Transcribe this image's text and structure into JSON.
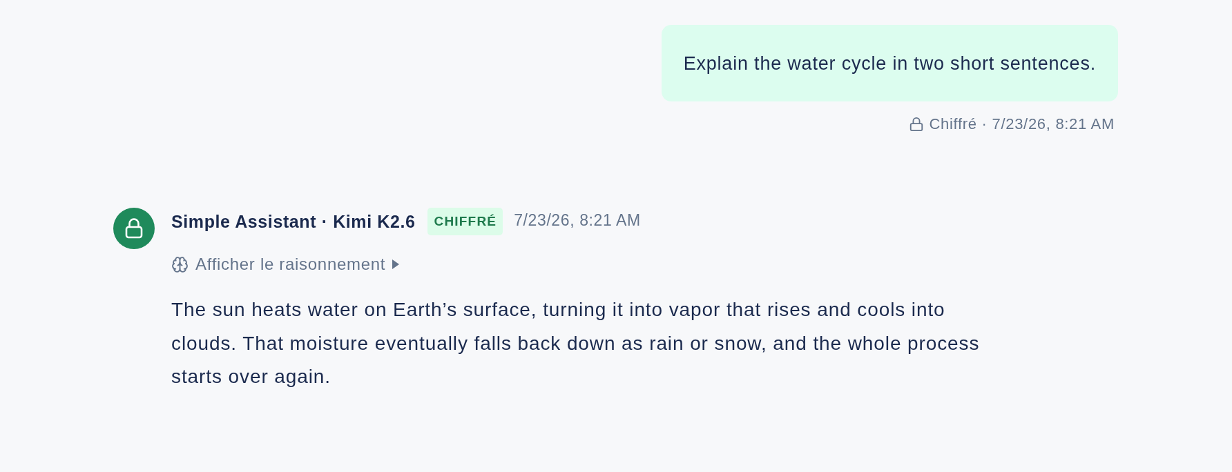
{
  "user_message": {
    "text": "Explain the water cycle in two short sentences.",
    "meta": "Chiffré · 7/23/26, 8:21 AM"
  },
  "assistant_message": {
    "sender": "Simple Assistant · Kimi K2.6",
    "badge": "CHIFFRÉ",
    "time": "7/23/26, 8:21 AM",
    "reasoning_toggle": {
      "label": "Afficher le raisonnement",
      "expanded": false
    },
    "text": "The sun heats water on Earth’s surface, turning it into vapor that rises and cools into clouds. That moisture eventually falls back down as rain or snow, and the whole process starts over again."
  }
}
